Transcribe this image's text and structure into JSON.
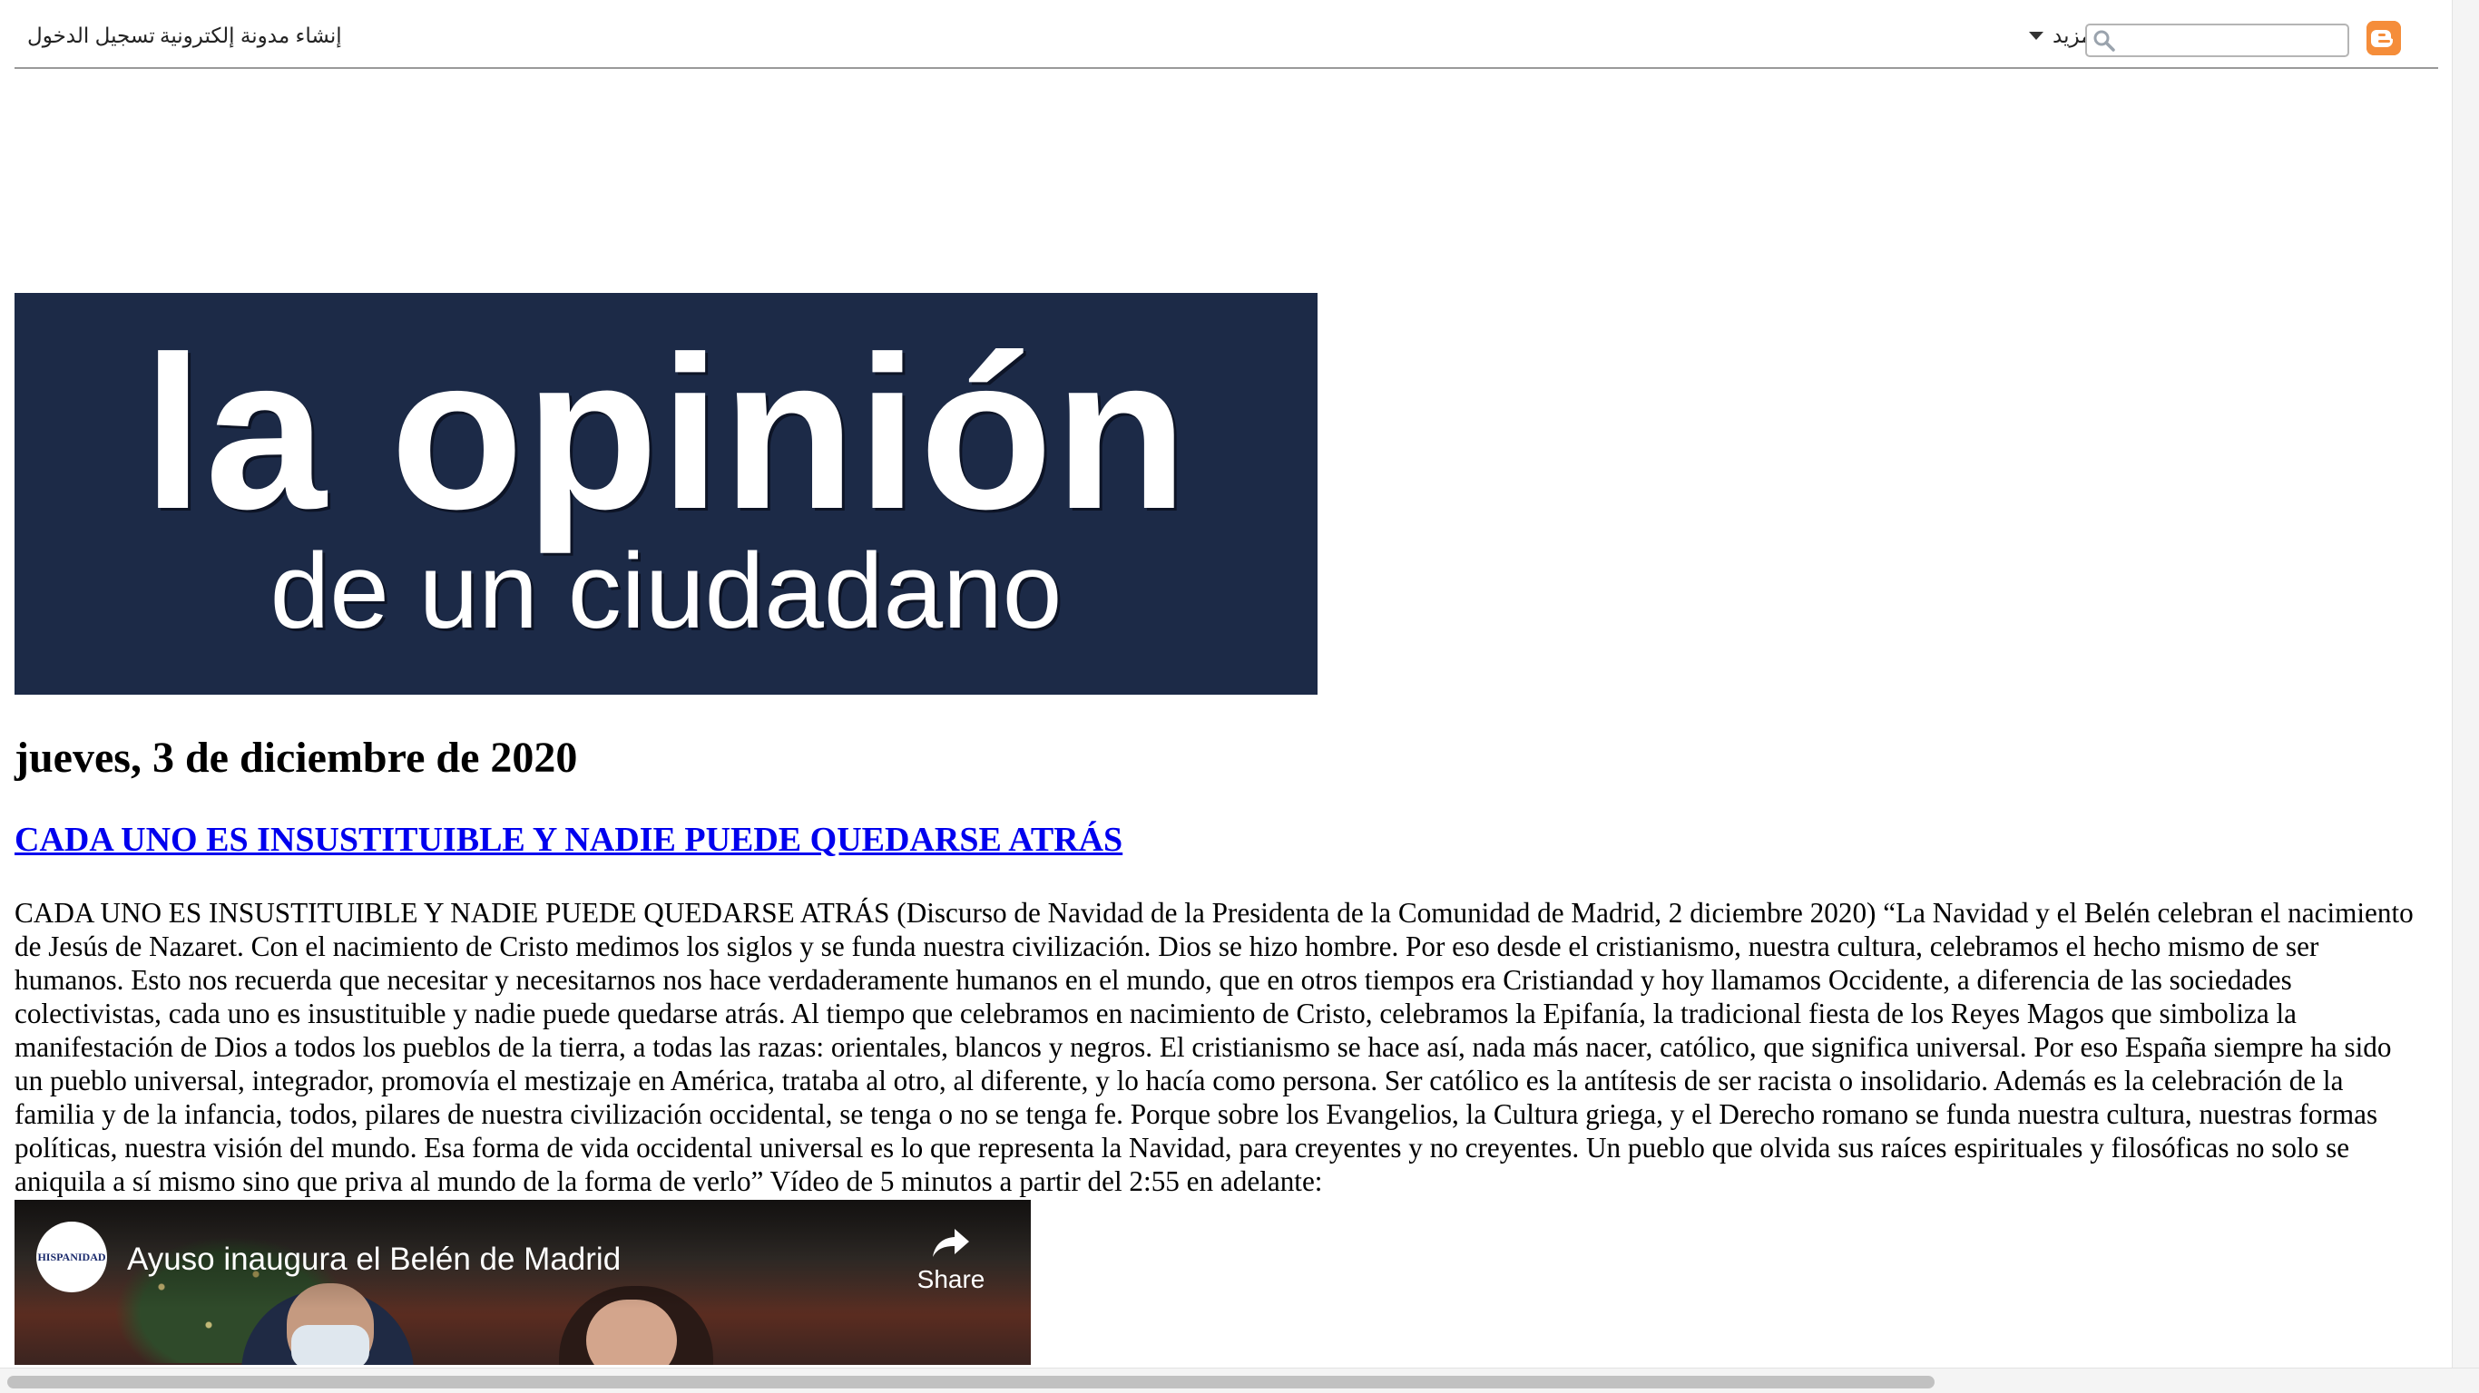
{
  "navbar": {
    "sign_in": "تسجيل الدخول",
    "create_blog": "إنشاء مدونة إلكترونية",
    "more": "المزيد",
    "search_value": "",
    "search_placeholder": "",
    "blogger_icon": "blogger-icon",
    "search_icon": "magnifier-icon",
    "accent_color": "#f58d3a"
  },
  "header": {
    "title": "la opinión",
    "subtitle": "de un ciudadano",
    "background_color": "#1c2a47"
  },
  "post": {
    "date": "jueves, 3 de diciembre de 2020",
    "title": "CADA UNO ES INSUSTITUIBLE Y NADIE PUEDE QUEDARSE ATRÁS",
    "body": "CADA UNO ES INSUSTITUIBLE Y NADIE PUEDE QUEDARSE ATRÁS (Discurso de Navidad de la Presidenta de la Comunidad de Madrid, 2 diciembre 2020) “La Navidad y el Belén celebran el nacimiento de Jesús de Nazaret. Con el nacimiento de Cristo medimos los siglos y se funda nuestra civilización. Dios se hizo hombre. Por eso desde el cristianismo, nuestra cultura, celebramos el hecho mismo de ser humanos. Esto nos recuerda que necesitar y necesitarnos nos hace verdaderamente humanos en el mundo, que en otros tiempos era Cristiandad y hoy llamamos Occidente, a diferencia de las sociedades colectivistas, cada uno es insustituible y nadie puede quedarse atrás. Al tiempo que celebramos en nacimiento de Cristo, celebramos la Epifanía, la tradicional fiesta de los Reyes Magos que simboliza la manifestación de Dios a todos los pueblos de la tierra, a todas las razas: orientales, blancos y negros. El cristianismo se hace así, nada más nacer, católico, que significa universal. Por eso España siempre ha sido un pueblo universal, integrador, promovía el mestizaje en América, trataba al otro, al diferente, y lo hacía como persona. Ser católico es la antítesis de ser racista o insolidario. Además es la celebración de la familia y de la infancia, todos, pilares de nuestra civilización occidental, se tenga o no se tenga fe. Porque sobre los Evangelios, la Cultura griega, y el Derecho romano se funda nuestra cultura, nuestras formas políticas, nuestra visión del mundo. Esa forma de vida occidental universal es lo que representa la Navidad, para creyentes y no creyentes. Un pueblo que olvida sus raíces espirituales y filosóficas no solo se aniquila a sí mismo sino que priva al mundo de la forma de verlo” Vídeo de 5 minutos a partir del 2:55 en adelante:"
  },
  "video": {
    "title": "Ayuso inaugura el Belén de Madrid",
    "share_label": "Share",
    "channel_avatar_text": "HISPANIDAD",
    "share_icon": "share-arrow-icon"
  }
}
